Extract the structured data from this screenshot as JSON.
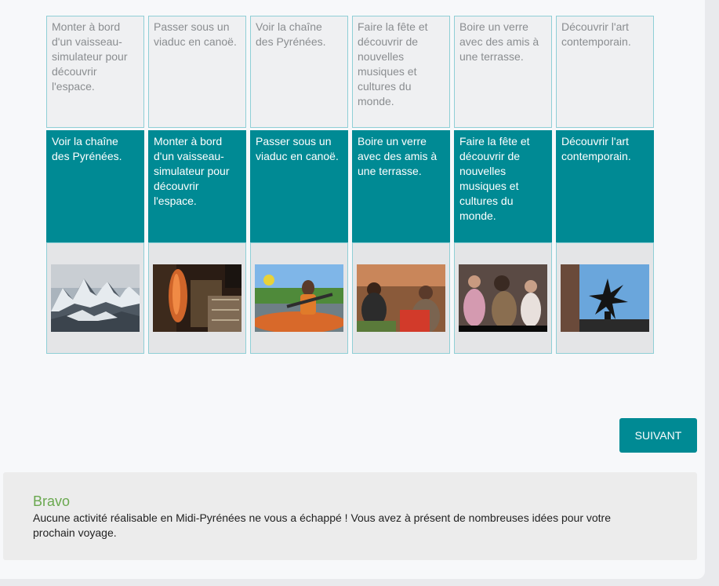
{
  "columns": [
    {
      "top_text": "Monter à bord d'un vaisseau-simulateur pour découvrir l'espace.",
      "answer_text": "Voir la chaîne des Pyrénées.",
      "image": "mountains-photo"
    },
    {
      "top_text": "Passer sous un viaduc en canoë.",
      "answer_text": "Monter à bord d'un vaisseau-simulateur pour découvrir l'espace.",
      "image": "simulator-photo"
    },
    {
      "top_text": "Voir la chaîne des Pyrénées.",
      "answer_text": "Passer sous un viaduc en canoë.",
      "image": "canoe-photo"
    },
    {
      "top_text": "Faire la fête et découvrir de nouvelles musiques et cultures du monde.",
      "answer_text": "Boire un verre avec des amis à une terrasse.",
      "image": "terrace-photo"
    },
    {
      "top_text": "Boire un verre avec des amis à une terrasse.",
      "answer_text": "Faire la fête et découvrir de nouvelles musiques et cultures du monde.",
      "image": "festival-photo"
    },
    {
      "top_text": "Découvrir l'art contemporain.",
      "answer_text": "Découvrir l'art contemporain.",
      "image": "sculpture-photo"
    }
  ],
  "next_button": "SUIVANT",
  "feedback": {
    "title": "Bravo",
    "text": "Aucune activité réalisable en Midi-Pyrénées ne vous a échappé ! Vous avez à présent de nombreuses idées pour votre prochain voyage."
  },
  "colors": {
    "accent": "#008a94",
    "success": "#6aa84f",
    "cell_border": "#8fcfd6"
  }
}
